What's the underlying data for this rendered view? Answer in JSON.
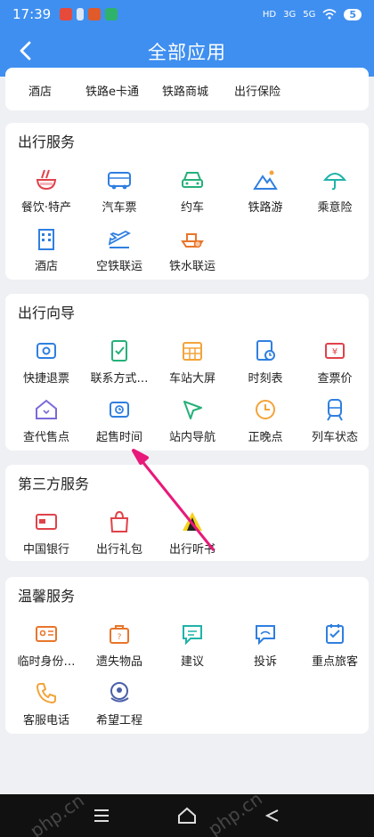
{
  "status": {
    "time": "17:39",
    "network": "5",
    "hd": "HD",
    "sig1": "3G",
    "sig2": "5G"
  },
  "header": {
    "title": "全部应用"
  },
  "top_partial": [
    "酒店",
    "铁路e卡通",
    "铁路商城",
    "出行保险"
  ],
  "sections": [
    {
      "title": "出行服务",
      "items": [
        "餐饮·特产",
        "汽车票",
        "约车",
        "铁路游",
        "乘意险",
        "酒店",
        "空铁联运",
        "铁水联运"
      ]
    },
    {
      "title": "出行向导",
      "items": [
        "快捷退票",
        "联系方式…",
        "车站大屏",
        "时刻表",
        "查票价",
        "查代售点",
        "起售时间",
        "站内导航",
        "正晚点",
        "列车状态"
      ]
    },
    {
      "title": "第三方服务",
      "items": [
        "中国银行",
        "出行礼包",
        "出行听书"
      ]
    },
    {
      "title": "温馨服务",
      "items": [
        "临时身份…",
        "遗失物品",
        "建议",
        "投诉",
        "重点旅客",
        "客服电话",
        "希望工程"
      ]
    }
  ],
  "colors": {
    "accent": "#3f8ff0",
    "annotation": "#e8197a"
  },
  "watermark": "php.cn"
}
